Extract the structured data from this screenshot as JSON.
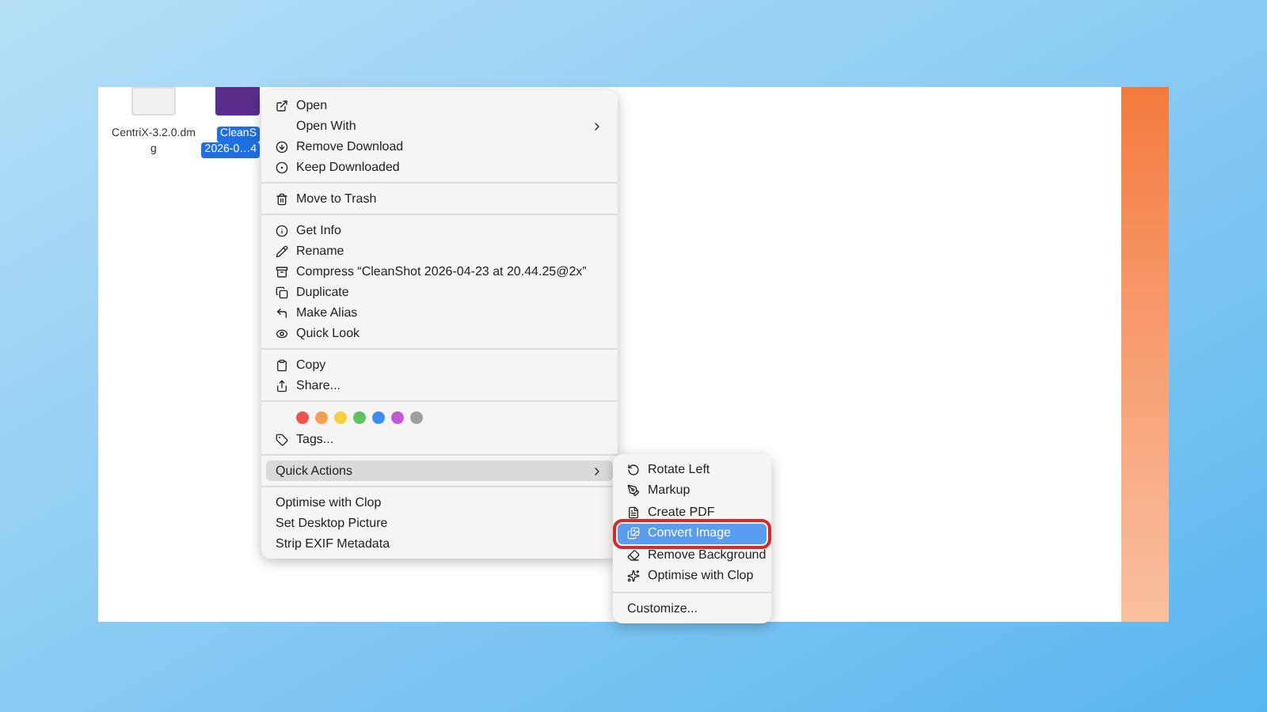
{
  "files": [
    {
      "lines": [
        "CentriX-3.2.0.dm",
        "g"
      ],
      "selected": false
    },
    {
      "lines": [
        "CleanS",
        "2026-0…4"
      ],
      "selected": true
    }
  ],
  "context_menu": {
    "sections": [
      [
        {
          "kind": "item",
          "label": "Open",
          "highlighted": false
        },
        {
          "kind": "submenu",
          "label": "Open With",
          "highlighted": false
        },
        {
          "kind": "item",
          "label": "Remove Download",
          "highlighted": false
        },
        {
          "kind": "item",
          "label": "Keep Downloaded",
          "highlighted": false
        }
      ],
      [
        {
          "kind": "item",
          "label": "Move to Trash",
          "highlighted": false
        }
      ],
      [
        {
          "kind": "item",
          "label": "Get Info",
          "highlighted": false
        },
        {
          "kind": "item",
          "label": "Rename",
          "highlighted": false
        },
        {
          "kind": "item",
          "label": "Compress “CleanShot 2026-04-23 at 20.44.25@2x”",
          "highlighted": false
        },
        {
          "kind": "item",
          "label": "Duplicate",
          "highlighted": false
        },
        {
          "kind": "item",
          "label": "Make Alias",
          "highlighted": false
        },
        {
          "kind": "item",
          "label": "Quick Look",
          "highlighted": false
        }
      ],
      [
        {
          "kind": "item",
          "label": "Copy",
          "highlighted": false
        },
        {
          "kind": "item",
          "label": "Share...",
          "highlighted": false
        }
      ],
      [
        {
          "kind": "tags",
          "dots": [
            {
              "color": "#ef5350"
            },
            {
              "color": "#f5a04a"
            },
            {
              "color": "#f5cf3d"
            },
            {
              "color": "#5cc35e"
            },
            {
              "color": "#3f8ef5"
            },
            {
              "color": "#c05ad7"
            },
            {
              "color": "#9e9e9e"
            }
          ]
        },
        {
          "kind": "item",
          "label": "Tags...",
          "highlighted": false
        }
      ],
      [
        {
          "kind": "submenu",
          "label": "Quick Actions",
          "highlighted": true
        }
      ],
      [
        {
          "kind": "item",
          "label": "Optimise with Clop",
          "highlighted": false
        },
        {
          "kind": "item",
          "label": "Set Desktop Picture",
          "highlighted": false
        },
        {
          "kind": "item",
          "label": "Strip EXIF Metadata",
          "highlighted": false
        }
      ]
    ]
  },
  "quick_actions_menu": {
    "items": [
      {
        "label": "Rotate Left",
        "highlighted": false,
        "outlined": false
      },
      {
        "label": "Markup",
        "highlighted": false,
        "outlined": false
      },
      {
        "label": "Create PDF",
        "highlighted": false,
        "outlined": false
      },
      {
        "label": "Convert Image",
        "highlighted": true,
        "outlined": true
      },
      {
        "label": "Remove Background",
        "highlighted": false,
        "outlined": false
      },
      {
        "label": "Optimise with Clop",
        "highlighted": false,
        "outlined": false
      }
    ],
    "footer": "Customize..."
  }
}
